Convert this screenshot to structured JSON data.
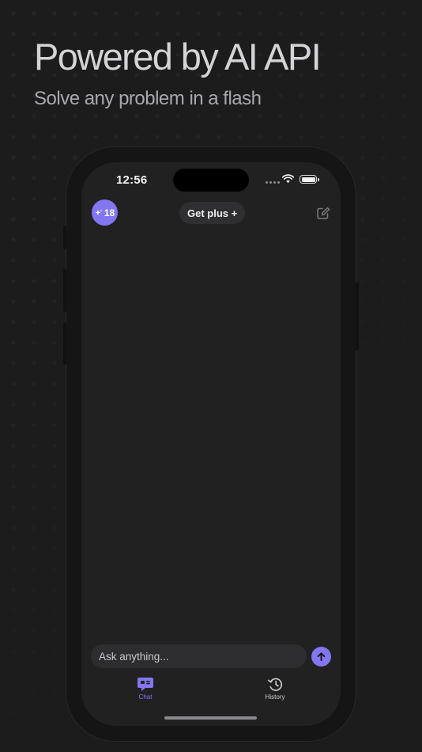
{
  "promo": {
    "headline": "Powered by AI API",
    "subheadline": "Solve any problem in a flash"
  },
  "status_bar": {
    "time": "12:56",
    "icons": [
      "cellular-signal-icon",
      "wifi-icon",
      "battery-icon"
    ]
  },
  "header": {
    "credits_icon": "sparkle-icon",
    "credits_count": "18",
    "get_plus_label": "Get plus +",
    "compose_icon": "new-chat-icon"
  },
  "composer": {
    "placeholder": "Ask anything...",
    "send_icon": "arrow-up-icon"
  },
  "tab_bar": {
    "tabs": [
      {
        "label": "Chat",
        "icon": "chat-bubble-icon",
        "active": true
      },
      {
        "label": "History",
        "icon": "history-clock-icon",
        "active": false
      }
    ]
  },
  "colors": {
    "accent": "#8277f0",
    "background": "#1c1c1d",
    "screen": "#212122",
    "pill": "#2f2f31",
    "input": "#2d2d2f"
  }
}
